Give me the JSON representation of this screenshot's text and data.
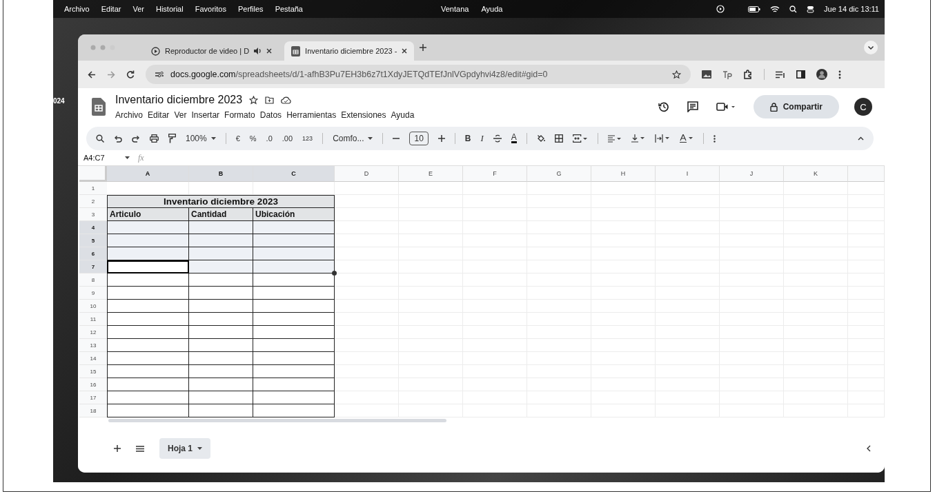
{
  "menubar": {
    "left_items": [
      "Archivo",
      "Editar",
      "Ver",
      "Historial",
      "Favoritos",
      "Perfiles",
      "Pestaña"
    ],
    "center_items": [
      "Ventana",
      "Ayuda"
    ],
    "clock": "Jue 14 dic 13:11"
  },
  "desktop": {
    "label": "024"
  },
  "tabs": [
    {
      "label": "Reproductor de video | D",
      "selected": false,
      "kind": "video"
    },
    {
      "label": "Inventario diciembre 2023 -",
      "selected": true,
      "kind": "sheet"
    }
  ],
  "address_bar": {
    "host": "docs.google.com",
    "path": "/spreadsheets/d/1-afhB3Pu7EH3b6z7t1XdyJETQdTEfJnlVGpdyhvi4z8/edit#gid=0"
  },
  "document": {
    "title": "Inventario diciembre 2023",
    "menus": [
      "Archivo",
      "Editar",
      "Ver",
      "Insertar",
      "Formato",
      "Datos",
      "Herramientas",
      "Extensiones",
      "Ayuda"
    ],
    "share_label": "Compartir",
    "avatar": "C"
  },
  "toolbar": {
    "zoom": "100%",
    "currency": "€",
    "percent": "%",
    "decrease_decimals": ".0",
    "increase_decimals": ".00",
    "number_format": "123",
    "font": "Comfo...",
    "font_size": "10",
    "bold": "B",
    "italic": "I",
    "text_color": "A"
  },
  "formula_bar": {
    "name_box": "A4:C7",
    "fx": "fx"
  },
  "sheet": {
    "columns": [
      {
        "label": "A",
        "selected": true
      },
      {
        "label": "B",
        "selected": true
      },
      {
        "label": "C",
        "selected": true
      },
      {
        "label": "D",
        "selected": false
      },
      {
        "label": "E",
        "selected": false
      },
      {
        "label": "F",
        "selected": false
      },
      {
        "label": "G",
        "selected": false
      },
      {
        "label": "H",
        "selected": false
      },
      {
        "label": "I",
        "selected": false
      },
      {
        "label": "J",
        "selected": false
      },
      {
        "label": "K",
        "selected": false
      }
    ],
    "table": {
      "title": "Inventario diciembre 2023",
      "headers": [
        "Articulo",
        "Cantidad",
        "Ubicación"
      ]
    },
    "rows": [
      {
        "label": "1",
        "selected": false,
        "active": false
      },
      {
        "label": "2",
        "selected": false,
        "active": false
      },
      {
        "label": "3",
        "selected": false,
        "active": false
      },
      {
        "label": "4",
        "selected": true,
        "active": false
      },
      {
        "label": "5",
        "selected": true,
        "active": false
      },
      {
        "label": "6",
        "selected": true,
        "active": false
      },
      {
        "label": "7",
        "selected": true,
        "active": true
      },
      {
        "label": "8",
        "selected": false,
        "active": false
      },
      {
        "label": "9",
        "selected": false,
        "active": false
      },
      {
        "label": "10",
        "selected": false,
        "active": false
      },
      {
        "label": "11",
        "selected": false,
        "active": false
      },
      {
        "label": "12",
        "selected": false,
        "active": false
      },
      {
        "label": "13",
        "selected": false,
        "active": false
      },
      {
        "label": "14",
        "selected": false,
        "active": false
      },
      {
        "label": "15",
        "selected": false,
        "active": false
      },
      {
        "label": "16",
        "selected": false,
        "active": false
      },
      {
        "label": "17",
        "selected": false,
        "active": false
      },
      {
        "label": "18",
        "selected": false,
        "active": false
      }
    ]
  },
  "sheet_tabs": [
    {
      "label": "Hoja 1",
      "selected": true
    }
  ]
}
